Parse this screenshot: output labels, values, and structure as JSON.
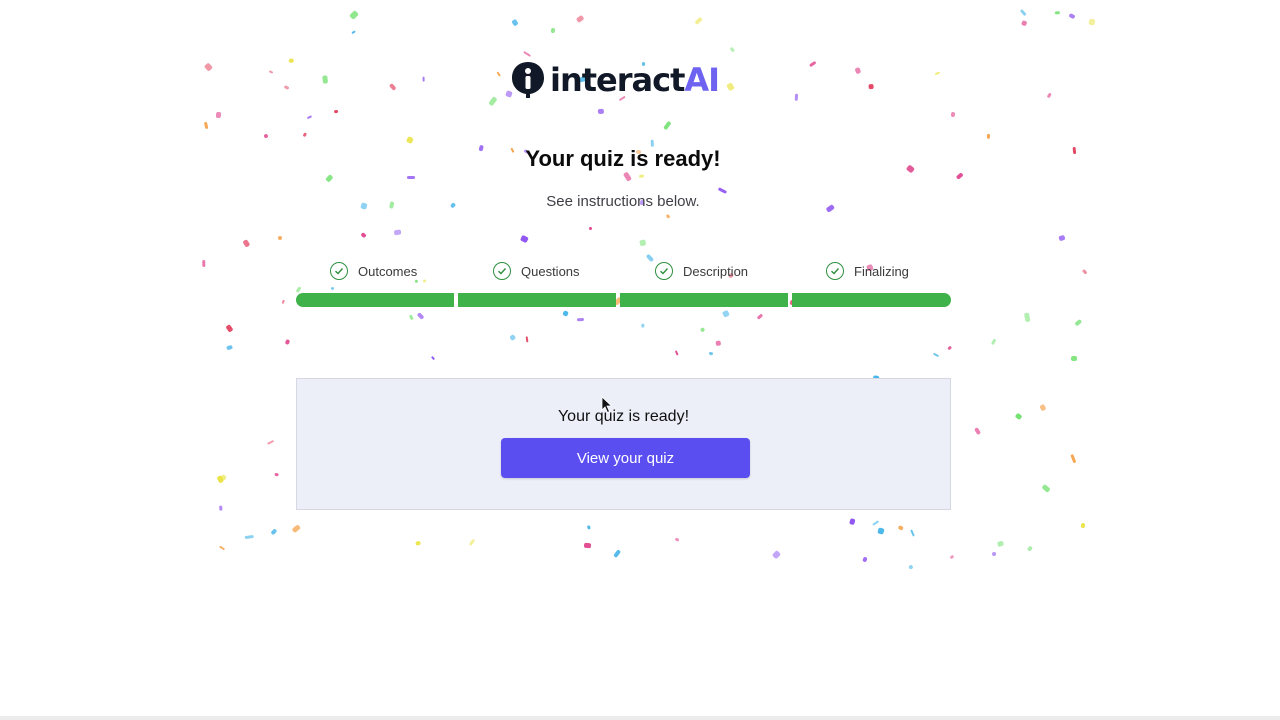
{
  "brand": {
    "name_prefix": "interact",
    "name_accent": "AI",
    "accent_color": "#6d63f0"
  },
  "header": {
    "title": "Your quiz is ready!",
    "subtitle": "See instructions below."
  },
  "steps": [
    {
      "label": "Outcomes",
      "status": "complete",
      "icon": "check-circle-icon"
    },
    {
      "label": "Questions",
      "status": "complete",
      "icon": "check-circle-icon"
    },
    {
      "label": "Description",
      "status": "complete",
      "icon": "check-circle-icon"
    },
    {
      "label": "Finalizing",
      "status": "complete",
      "icon": "check-circle-icon"
    }
  ],
  "progress": {
    "completed_segments": 4,
    "total_segments": 4,
    "color": "#3fb24a"
  },
  "card": {
    "title": "Your quiz is ready!",
    "button_label": "View your quiz",
    "button_color": "#5b4ef0"
  },
  "confetti_colors": [
    "#e0408a",
    "#8a4ef0",
    "#f59e42",
    "#3ab0e8",
    "#e8e23a",
    "#6ee06b",
    "#e23a5b"
  ]
}
